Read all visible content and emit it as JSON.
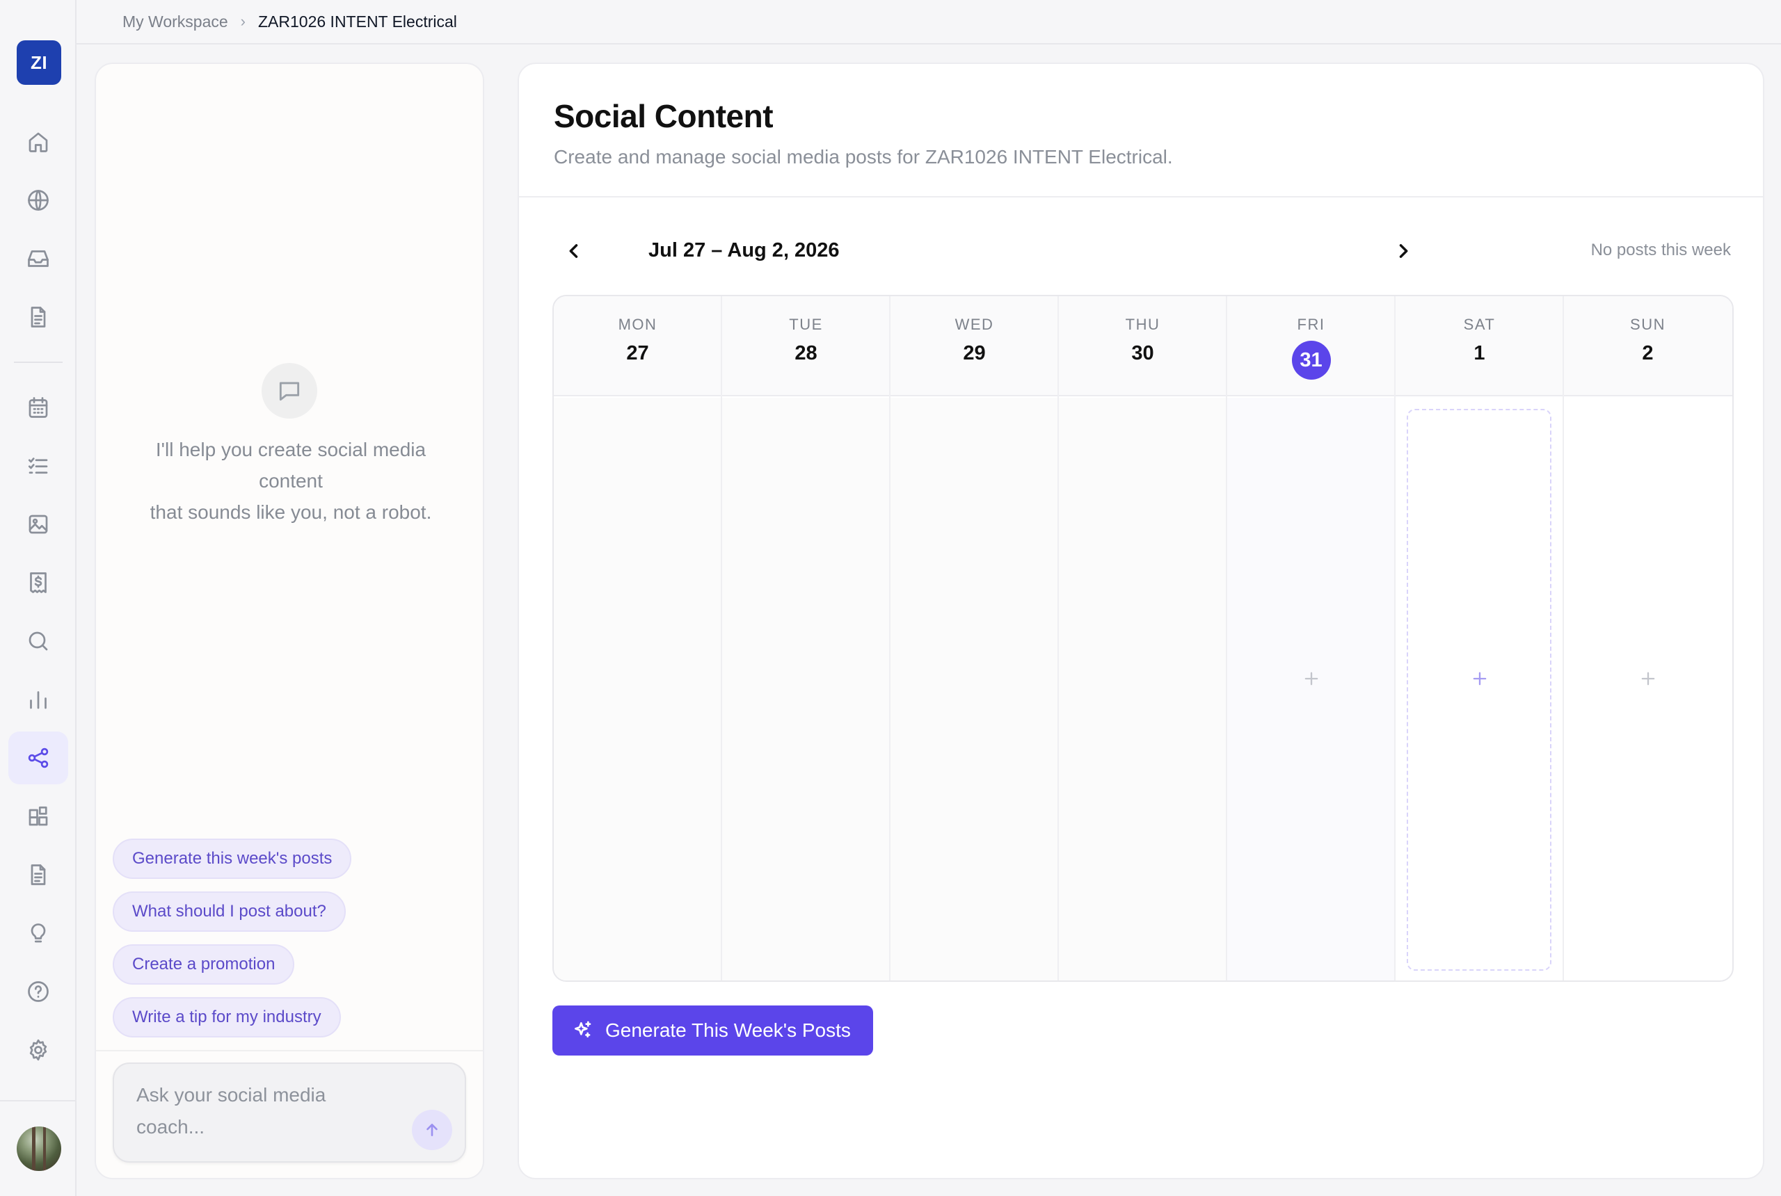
{
  "workspace": {
    "initials": "ZI"
  },
  "breadcrumb": {
    "root": "My Workspace",
    "current": "ZAR1026 INTENT Electrical"
  },
  "rail": {
    "items": [
      {
        "name": "home-icon"
      },
      {
        "name": "globe-icon"
      },
      {
        "name": "inbox-icon"
      },
      {
        "name": "document-icon"
      },
      {
        "name": "calendar-icon"
      },
      {
        "name": "checklist-icon"
      },
      {
        "name": "image-icon"
      },
      {
        "name": "invoice-icon"
      },
      {
        "name": "search-icon"
      },
      {
        "name": "bar-chart-icon"
      },
      {
        "name": "share-icon",
        "active": true
      },
      {
        "name": "widgets-icon"
      },
      {
        "name": "notes-icon"
      },
      {
        "name": "lightbulb-icon"
      },
      {
        "name": "help-icon"
      },
      {
        "name": "gear-icon"
      }
    ]
  },
  "chat": {
    "intro_line1": "I'll help you create social media",
    "intro_line2": "content",
    "intro_line3": "that sounds like you, not a robot.",
    "suggestions": [
      "Generate this week's posts",
      "What should I post about?",
      "Create a promotion",
      "Write a tip for my industry"
    ],
    "input_placeholder": "Ask your social media coach...",
    "input_value": ""
  },
  "main": {
    "title": "Social Content",
    "subtitle": "Create and manage social media posts for ZAR1026 INTENT Electrical.",
    "week_range": "Jul 27 – Aug 2, 2026",
    "week_status": "No posts this week",
    "days": [
      {
        "name": "MON",
        "num": "27"
      },
      {
        "name": "TUE",
        "num": "28"
      },
      {
        "name": "WED",
        "num": "29"
      },
      {
        "name": "THU",
        "num": "30"
      },
      {
        "name": "FRI",
        "num": "31",
        "today": true
      },
      {
        "name": "SAT",
        "num": "1"
      },
      {
        "name": "SUN",
        "num": "2"
      }
    ],
    "generate_button": "Generate This Week's Posts"
  },
  "colors": {
    "accent": "#5b45ea",
    "workspace_badge": "#1e40af",
    "chip_bg": "#eeebfb",
    "chip_text": "#5b4ac9"
  }
}
